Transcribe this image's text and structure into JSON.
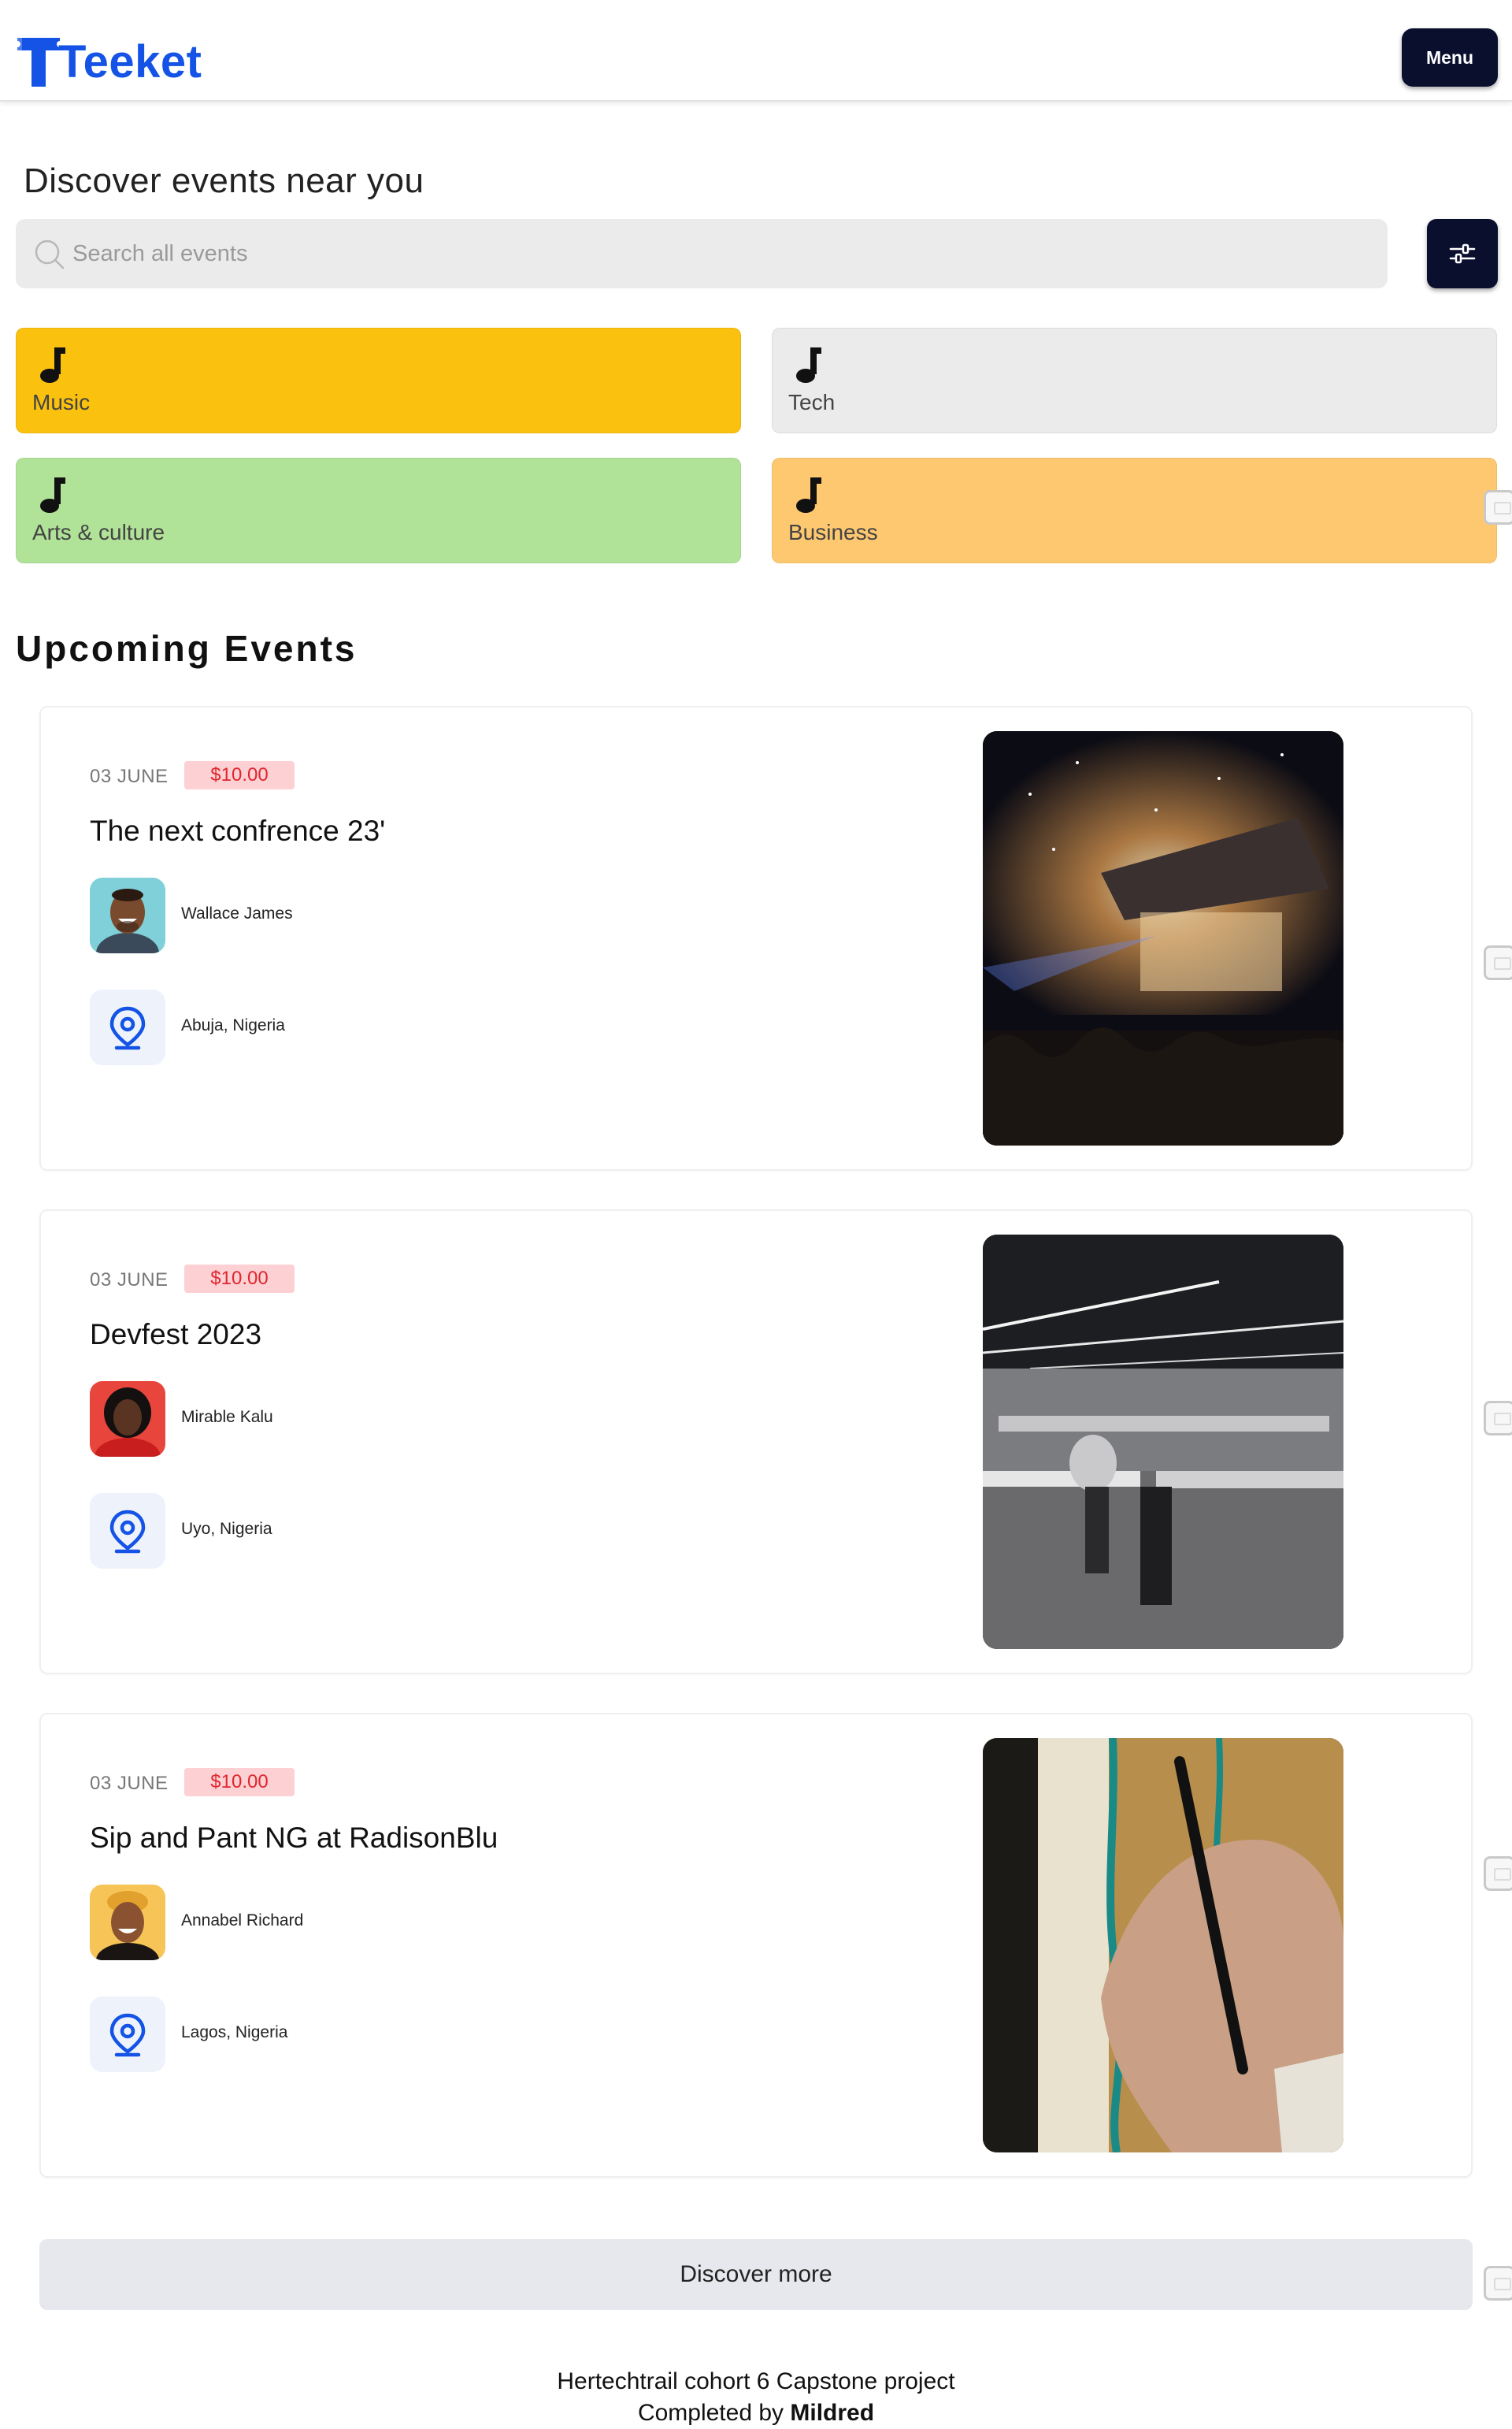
{
  "header": {
    "brand": "Teeket",
    "menu_label": "Menu"
  },
  "discover": {
    "title": "Discover events near you",
    "search_placeholder": "Search all events"
  },
  "categories": [
    {
      "label": "Music",
      "color": "#fac10e",
      "icon": "music-note-icon"
    },
    {
      "label": "Tech",
      "color": "#ebebeb",
      "icon": "music-note-icon"
    },
    {
      "label": "Arts & culture",
      "color": "#b0e298",
      "icon": "music-note-icon"
    },
    {
      "label": "Business",
      "color": "#fec870",
      "icon": "music-note-icon"
    }
  ],
  "upcoming": {
    "title": "Upcoming Events",
    "events": [
      {
        "date": "03 JUNE",
        "price": "$10.00",
        "title": "The next confrence 23'",
        "host": "Wallace James",
        "location": "Abuja, Nigeria",
        "image": "concert-photo"
      },
      {
        "date": "03 JUNE",
        "price": "$10.00",
        "title": "Devfest 2023",
        "host": "Mirable Kalu",
        "location": "Uyo, Nigeria",
        "image": "office-photo"
      },
      {
        "date": "03 JUNE",
        "price": "$10.00",
        "title": "Sip and Pant NG at RadisonBlu",
        "host": "Annabel Richard",
        "location": "Lagos, Nigeria",
        "image": "painting-photo"
      }
    ]
  },
  "discover_more_label": "Discover more",
  "footer": {
    "line1": "Hertechtrail cohort 6 Capstone project",
    "line2_prefix": "Completed by",
    "line2_name": "Mildred"
  },
  "colors": {
    "brand_blue": "#1453e6",
    "dark_navy": "#0a0f2e",
    "price_bg": "#fdd0d3",
    "price_text": "#e0262f"
  }
}
